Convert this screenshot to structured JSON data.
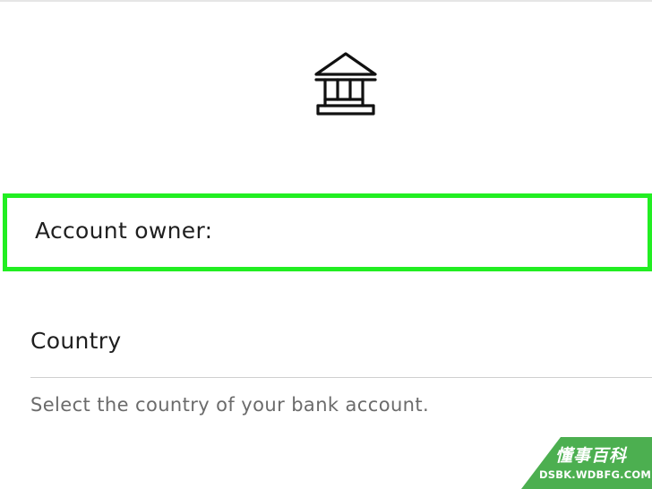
{
  "icon": "bank-icon",
  "account_owner": {
    "label": "Account owner:",
    "highlight_color": "#22ee22"
  },
  "country": {
    "label": "Country",
    "help_text": "Select the country of your bank account."
  },
  "watermark": {
    "brand": "懂事百科",
    "site": "DSBK.WDBFG.COM",
    "color": "#4caf50"
  }
}
